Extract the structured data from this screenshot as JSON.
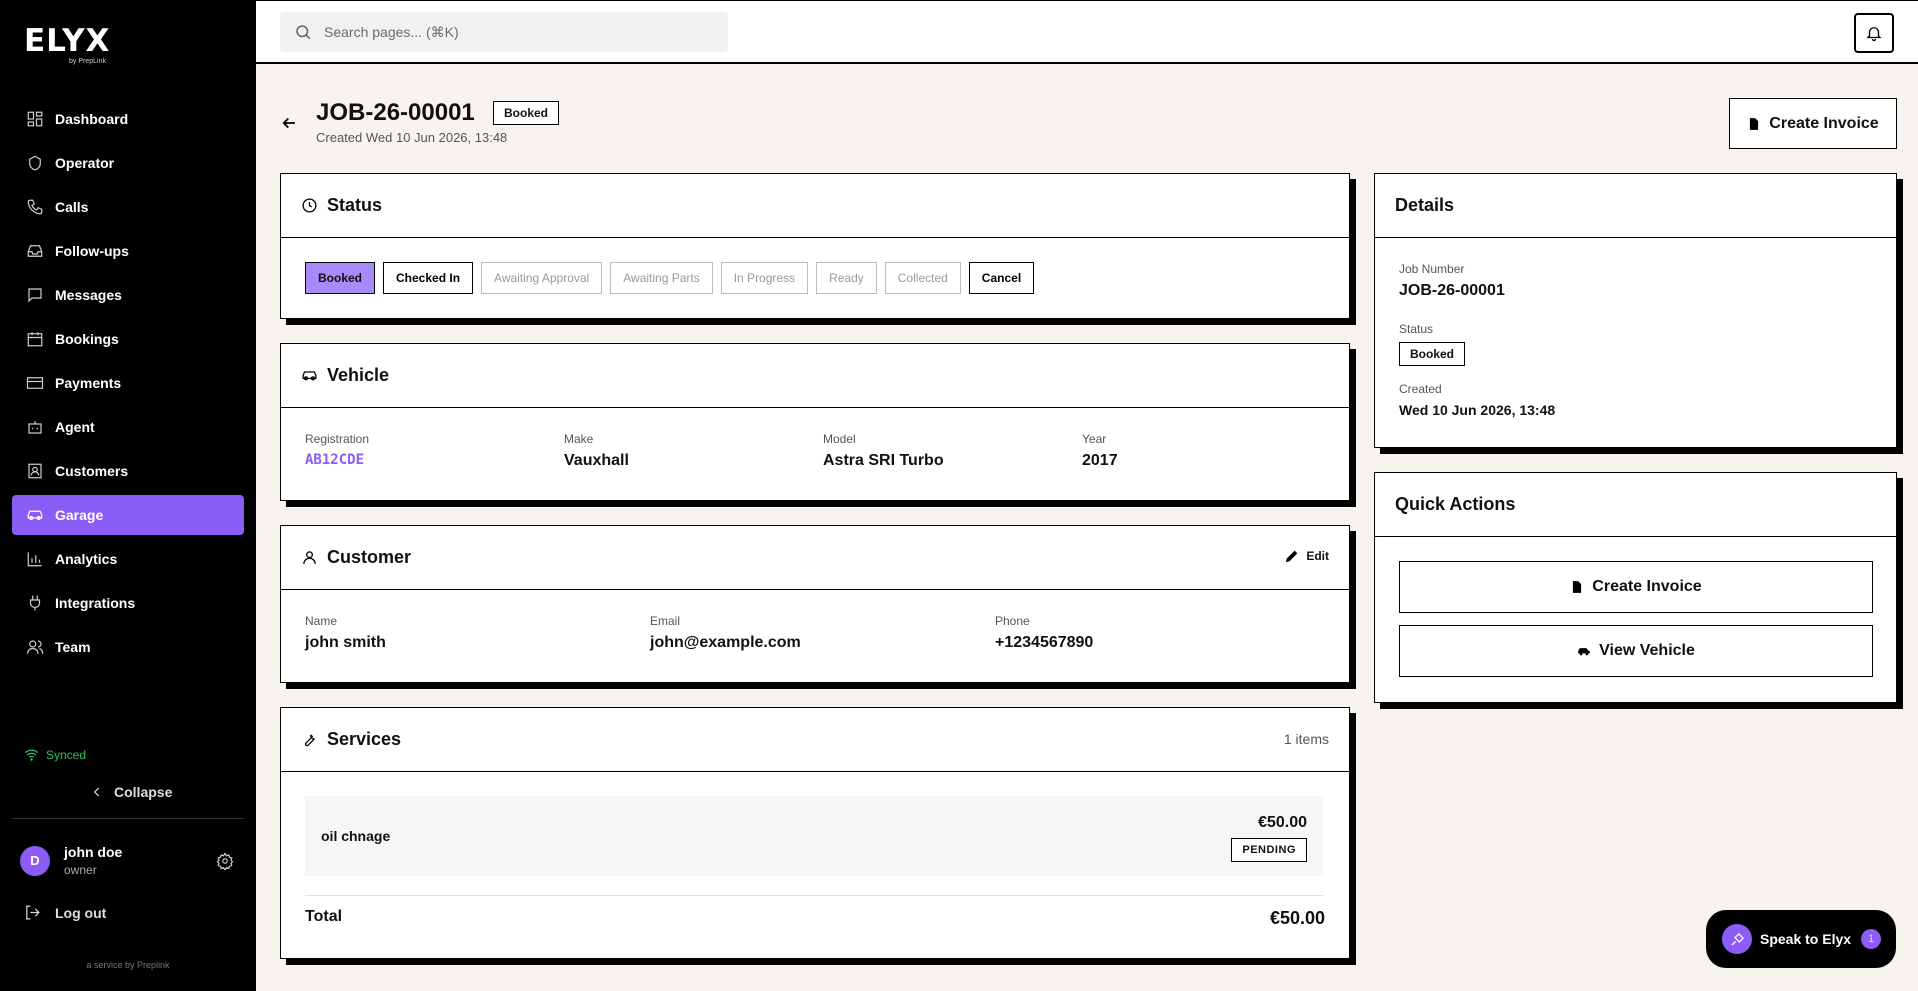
{
  "brand": {
    "name": "ELYX",
    "sub": "by PrepLink"
  },
  "search": {
    "placeholder": "Search pages... (⌘K)"
  },
  "sidebar": {
    "items": [
      {
        "label": "Dashboard",
        "icon": "dashboard-icon"
      },
      {
        "label": "Operator",
        "icon": "operator-icon"
      },
      {
        "label": "Calls",
        "icon": "phone-icon"
      },
      {
        "label": "Follow-ups",
        "icon": "inbox-icon"
      },
      {
        "label": "Messages",
        "icon": "message-icon"
      },
      {
        "label": "Bookings",
        "icon": "calendar-icon"
      },
      {
        "label": "Payments",
        "icon": "card-icon"
      },
      {
        "label": "Agent",
        "icon": "bot-icon"
      },
      {
        "label": "Customers",
        "icon": "contact-icon"
      },
      {
        "label": "Garage",
        "icon": "car-icon",
        "active": true
      },
      {
        "label": "Analytics",
        "icon": "chart-icon"
      },
      {
        "label": "Integrations",
        "icon": "plug-icon"
      },
      {
        "label": "Team",
        "icon": "team-icon"
      }
    ],
    "synced": "Synced",
    "collapse": "Collapse",
    "user": {
      "initial": "D",
      "name": "john doe",
      "role": "owner"
    },
    "logout": "Log out",
    "service": "a service by Preplink"
  },
  "header": {
    "job_number": "JOB-26-00001",
    "status_badge": "Booked",
    "created": "Created Wed 10 Jun 2026, 13:48",
    "create_invoice": "Create Invoice"
  },
  "status": {
    "title": "Status",
    "buttons": [
      "Booked",
      "Checked In",
      "Awaiting Approval",
      "Awaiting Parts",
      "In Progress",
      "Ready",
      "Collected",
      "Cancel"
    ]
  },
  "vehicle": {
    "title": "Vehicle",
    "registration_label": "Registration",
    "registration": "AB12CDE",
    "make_label": "Make",
    "make": "Vauxhall",
    "model_label": "Model",
    "model": "Astra SRI Turbo",
    "year_label": "Year",
    "year": "2017"
  },
  "customer": {
    "title": "Customer",
    "edit": "Edit",
    "name_label": "Name",
    "name": "john smith",
    "email_label": "Email",
    "email": "john@example.com",
    "phone_label": "Phone",
    "phone": "+1234567890"
  },
  "services": {
    "title": "Services",
    "count": "1 items",
    "items": [
      {
        "name": "oil chnage",
        "price": "€50.00",
        "status": "PENDING"
      }
    ],
    "total_label": "Total",
    "total": "€50.00"
  },
  "details": {
    "title": "Details",
    "job_label": "Job Number",
    "job": "JOB-26-00001",
    "status_label": "Status",
    "status": "Booked",
    "created_label": "Created",
    "created": "Wed 10 Jun 2026, 13:48"
  },
  "quick_actions": {
    "title": "Quick Actions",
    "create_invoice": "Create Invoice",
    "view_vehicle": "View Vehicle"
  },
  "speak": {
    "label": "Speak to Elyx",
    "count": "1"
  },
  "colors": {
    "accent": "#8b5cf6",
    "accent_light": "#a78bfa",
    "synced": "#22c55e",
    "background": "#f7f3ee"
  }
}
